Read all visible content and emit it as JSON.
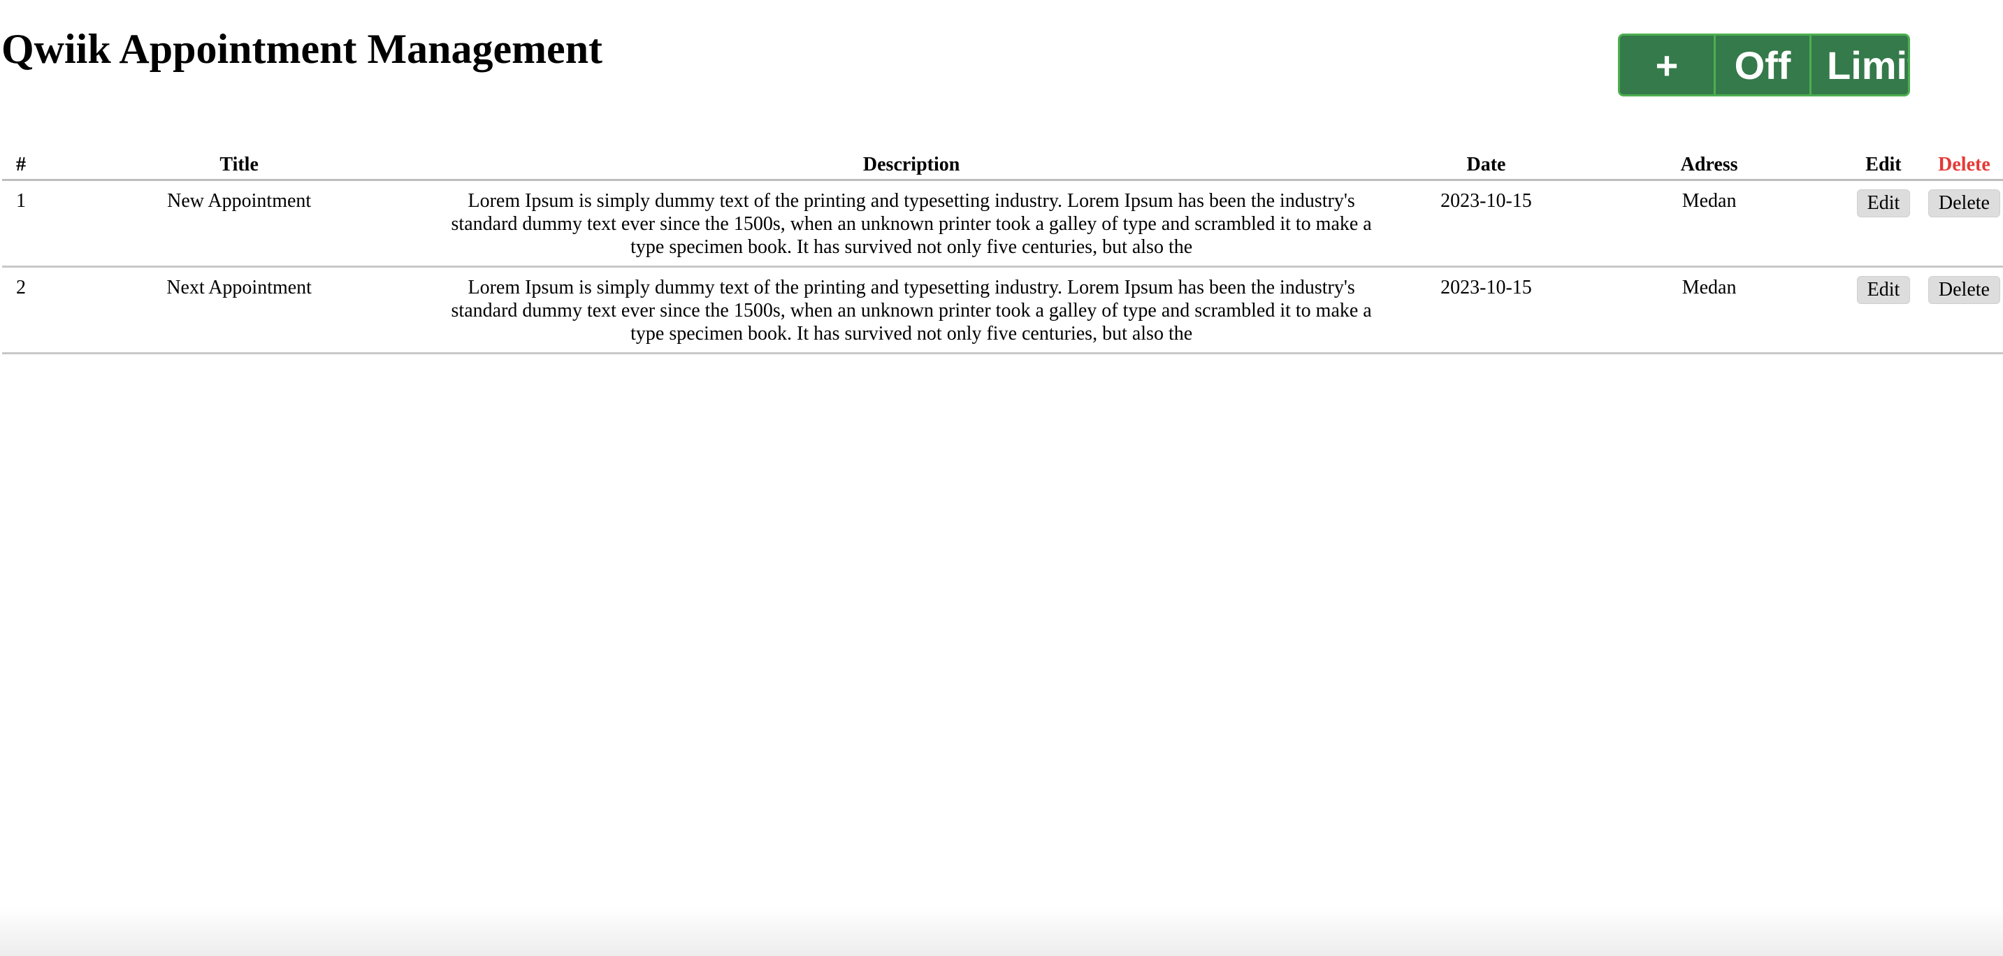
{
  "page": {
    "title": "Qwiik Appointment Management"
  },
  "toolbar": {
    "add_label": "+",
    "off_label": "Off",
    "limit_label": "Limit",
    "color": "#357a4a",
    "border_color": "#4caf50"
  },
  "table": {
    "headers": {
      "num": "#",
      "title": "Title",
      "description": "Description",
      "date": "Date",
      "address": "Adress",
      "edit": "Edit",
      "delete": "Delete"
    },
    "delete_header_color": "#e53935",
    "rows": [
      {
        "num": "1",
        "title": "New Appointment",
        "description": "Lorem Ipsum is simply dummy text of the printing and typesetting industry. Lorem Ipsum has been the industry's standard dummy text ever since the 1500s, when an unknown printer took a galley of type and scrambled it to make a type specimen book. It has survived not only five centuries, but also the",
        "date": "2023-10-15",
        "address": "Medan",
        "edit_label": "Edit",
        "delete_label": "Delete"
      },
      {
        "num": "2",
        "title": "Next Appointment",
        "description": "Lorem Ipsum is simply dummy text of the printing and typesetting industry. Lorem Ipsum has been the industry's standard dummy text ever since the 1500s, when an unknown printer took a galley of type and scrambled it to make a type specimen book. It has survived not only five centuries, but also the",
        "date": "2023-10-15",
        "address": "Medan",
        "edit_label": "Edit",
        "delete_label": "Delete"
      }
    ]
  }
}
